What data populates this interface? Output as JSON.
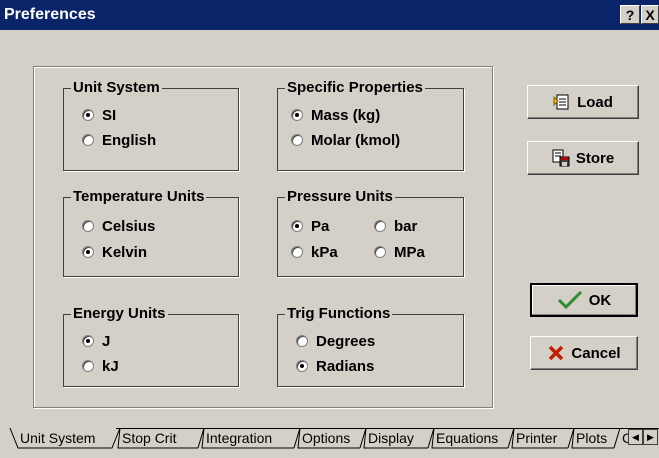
{
  "window": {
    "title": "Preferences",
    "help_button": "?",
    "close_button": "X"
  },
  "groups": {
    "unit_system": {
      "legend": "Unit System",
      "options": [
        "SI",
        "English"
      ],
      "selected": "SI"
    },
    "specific_properties": {
      "legend": "Specific Properties",
      "options": [
        "Mass (kg)",
        "Molar (kmol)"
      ],
      "selected": "Mass (kg)"
    },
    "temperature_units": {
      "legend": "Temperature Units",
      "options": [
        "Celsius",
        "Kelvin"
      ],
      "selected": "Kelvin"
    },
    "pressure_units": {
      "legend": "Pressure Units",
      "options": [
        "Pa",
        "bar",
        "kPa",
        "MPa"
      ],
      "selected": "Pa"
    },
    "energy_units": {
      "legend": "Energy Units",
      "options": [
        "J",
        "kJ"
      ],
      "selected": "J"
    },
    "trig_functions": {
      "legend": "Trig Functions",
      "options": [
        "Degrees",
        "Radians"
      ],
      "selected": "Radians"
    }
  },
  "buttons": {
    "load": "Load",
    "store": "Store",
    "ok": "OK",
    "cancel": "Cancel"
  },
  "tabs": [
    "Unit System",
    "Stop Crit",
    "Integration",
    "Options",
    "Display",
    "Equations",
    "Printer",
    "Plots",
    "C"
  ],
  "active_tab": "Unit System",
  "colors": {
    "title_bar": "#0a246a",
    "dialog_bg": "#d4d0c8",
    "ok_check": "#2e8b2e",
    "cancel_x": "#c02000"
  }
}
